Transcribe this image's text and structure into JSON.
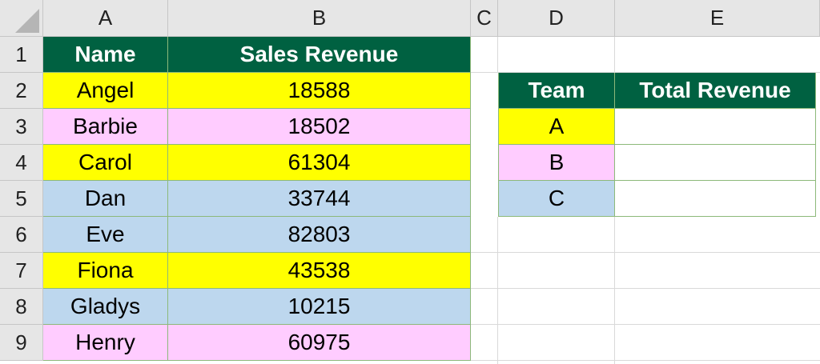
{
  "spreadsheet": {
    "columns": [
      "A",
      "B",
      "C",
      "D",
      "E"
    ],
    "rows": [
      "1",
      "2",
      "3",
      "4",
      "5",
      "6",
      "7",
      "8",
      "9"
    ],
    "colors": {
      "header_fill": "#006141",
      "yellow": "#ffff00",
      "pink": "#ffccff",
      "blue": "#bdd7ee",
      "border": "#8db97a"
    }
  },
  "sales_table": {
    "headers": [
      "Name",
      "Sales Revenue"
    ],
    "rows": [
      {
        "name": "Angel",
        "revenue": "18588",
        "color": "yellow"
      },
      {
        "name": "Barbie",
        "revenue": "18502",
        "color": "pink"
      },
      {
        "name": "Carol",
        "revenue": "61304",
        "color": "yellow"
      },
      {
        "name": "Dan",
        "revenue": "33744",
        "color": "blue"
      },
      {
        "name": "Eve",
        "revenue": "82803",
        "color": "blue"
      },
      {
        "name": "Fiona",
        "revenue": "43538",
        "color": "yellow"
      },
      {
        "name": "Gladys",
        "revenue": "10215",
        "color": "blue"
      },
      {
        "name": "Henry",
        "revenue": "60975",
        "color": "pink"
      }
    ]
  },
  "team_table": {
    "headers": [
      "Team",
      "Total Revenue"
    ],
    "rows": [
      {
        "team": "A",
        "total": "",
        "color": "yellow"
      },
      {
        "team": "B",
        "total": "",
        "color": "pink"
      },
      {
        "team": "C",
        "total": "",
        "color": "blue"
      }
    ]
  }
}
